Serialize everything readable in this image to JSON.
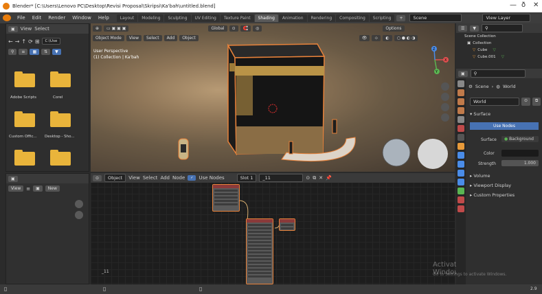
{
  "window": {
    "title": "Blender* [C:\\Users\\Lenovo PC\\Desktop\\Revisi Proposal\\Skripsi\\Ka'bah\\untitled.blend]",
    "minimize": "—",
    "maximize": "ð",
    "close": "✕"
  },
  "menubar": {
    "items": [
      "File",
      "Edit",
      "Render",
      "Window",
      "Help"
    ],
    "workspaces": [
      "Layout",
      "Modeling",
      "Sculpting",
      "UV Editing",
      "Texture Paint",
      "Shading",
      "Animation",
      "Rendering",
      "Compositing",
      "Scripting"
    ],
    "active_workspace": "Shading",
    "scene": "Scene",
    "view_layer": "View Layer"
  },
  "filebrowser": {
    "menu": [
      "View",
      "Select"
    ],
    "path_button": "C:\\Use",
    "folders": [
      "Adobe Scripts",
      "Corel",
      "Custom Offic...",
      "Desktop - Sho..."
    ]
  },
  "viewport": {
    "mode": "Object Mode",
    "menu": [
      "View",
      "Select",
      "Add",
      "Object"
    ],
    "transform": "Global",
    "options": "Options",
    "overlay_line1": "User Perspective",
    "overlay_line2": "(1) Collection | Ka'bah",
    "gizmo_axes": [
      "X",
      "Y",
      "Z"
    ]
  },
  "nodeeditor": {
    "type": "Object",
    "menu": [
      "View",
      "Select",
      "Add",
      "Node"
    ],
    "use_nodes_label": "Use Nodes",
    "slot": "Slot 1",
    "material": "_11",
    "frame_label": "_11"
  },
  "leftbottom": {
    "view": "View",
    "new": "New"
  },
  "outliner": {
    "title": "Scene Collection",
    "items": [
      "Collection",
      "Cube",
      "Cube.001"
    ]
  },
  "properties": {
    "breadcrumb_scene": "Scene",
    "breadcrumb_world": "World",
    "world_name": "World",
    "section_surface": "Surface",
    "use_nodes_btn": "Use Nodes",
    "surface_label": "Surface",
    "surface_value": "Background",
    "color_label": "Color",
    "strength_label": "Strength",
    "strength_value": "1.000",
    "sections": [
      "Volume",
      "Viewport Display",
      "Custom Properties"
    ]
  },
  "watermark": {
    "line1": "Activate Windows",
    "line2": "Go to Settings to activate Windows."
  },
  "statusbar": {
    "version": "2.9"
  },
  "colors": {
    "accent": "#4772b3",
    "selection": "#e8823a",
    "folder": "#e9b43b"
  }
}
